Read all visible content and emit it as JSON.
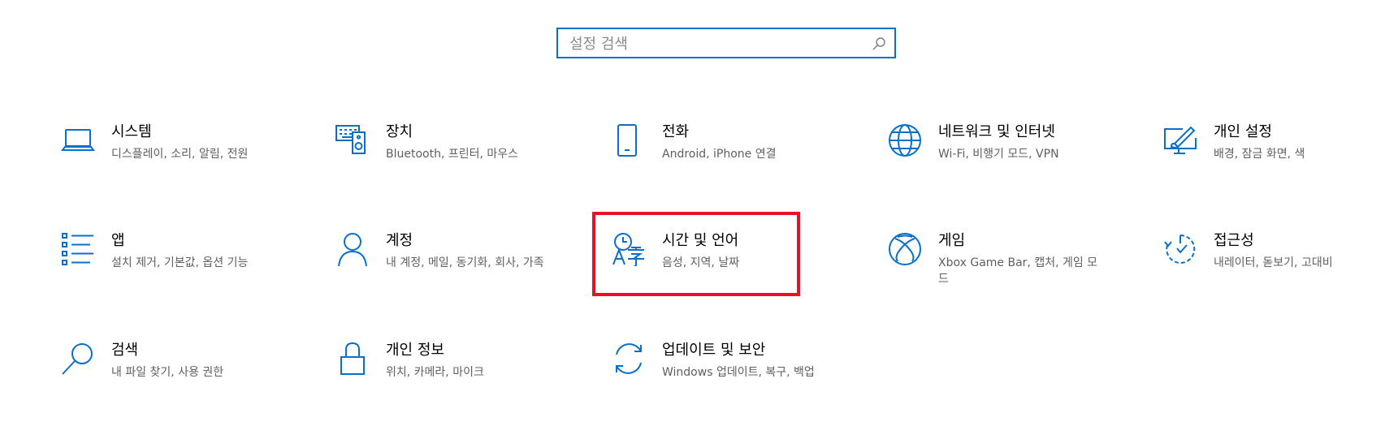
{
  "search": {
    "placeholder": "설정 검색",
    "icon": "search-icon"
  },
  "accent_color": "#0a6fc9",
  "highlight_color": "#e81123",
  "tiles": [
    {
      "title": "시스템",
      "desc": "디스플레이, 소리, 알림, 전원",
      "icon": "laptop-icon"
    },
    {
      "title": "장치",
      "desc": "Bluetooth, 프린터, 마우스",
      "icon": "devices-icon"
    },
    {
      "title": "전화",
      "desc": "Android, iPhone 연결",
      "icon": "phone-icon"
    },
    {
      "title": "네트워크 및 인터넷",
      "desc": "Wi-Fi, 비행기 모드, VPN",
      "icon": "globe-icon"
    },
    {
      "title": "개인 설정",
      "desc": "배경, 잠금 화면, 색",
      "icon": "personalization-icon"
    },
    {
      "title": "앱",
      "desc": "설치 제거, 기본값, 옵션 기능",
      "icon": "apps-list-icon"
    },
    {
      "title": "계정",
      "desc": "내 계정, 메일, 동기화, 회사, 가족",
      "icon": "person-icon"
    },
    {
      "title": "시간 및 언어",
      "desc": "음성, 지역, 날짜",
      "icon": "time-language-icon"
    },
    {
      "title": "게임",
      "desc": "Xbox Game Bar, 캡처, 게임 모드",
      "icon": "xbox-icon"
    },
    {
      "title": "접근성",
      "desc": "내레이터, 돋보기, 고대비",
      "icon": "accessibility-timer-icon"
    },
    {
      "title": "검색",
      "desc": "내 파일 찾기, 사용 권한",
      "icon": "magnifier-icon"
    },
    {
      "title": "개인 정보",
      "desc": "위치, 카메라, 마이크",
      "icon": "lock-icon"
    },
    {
      "title": "업데이트 및 보안",
      "desc": "Windows 업데이트, 복구, 백업",
      "icon": "sync-icon"
    }
  ]
}
